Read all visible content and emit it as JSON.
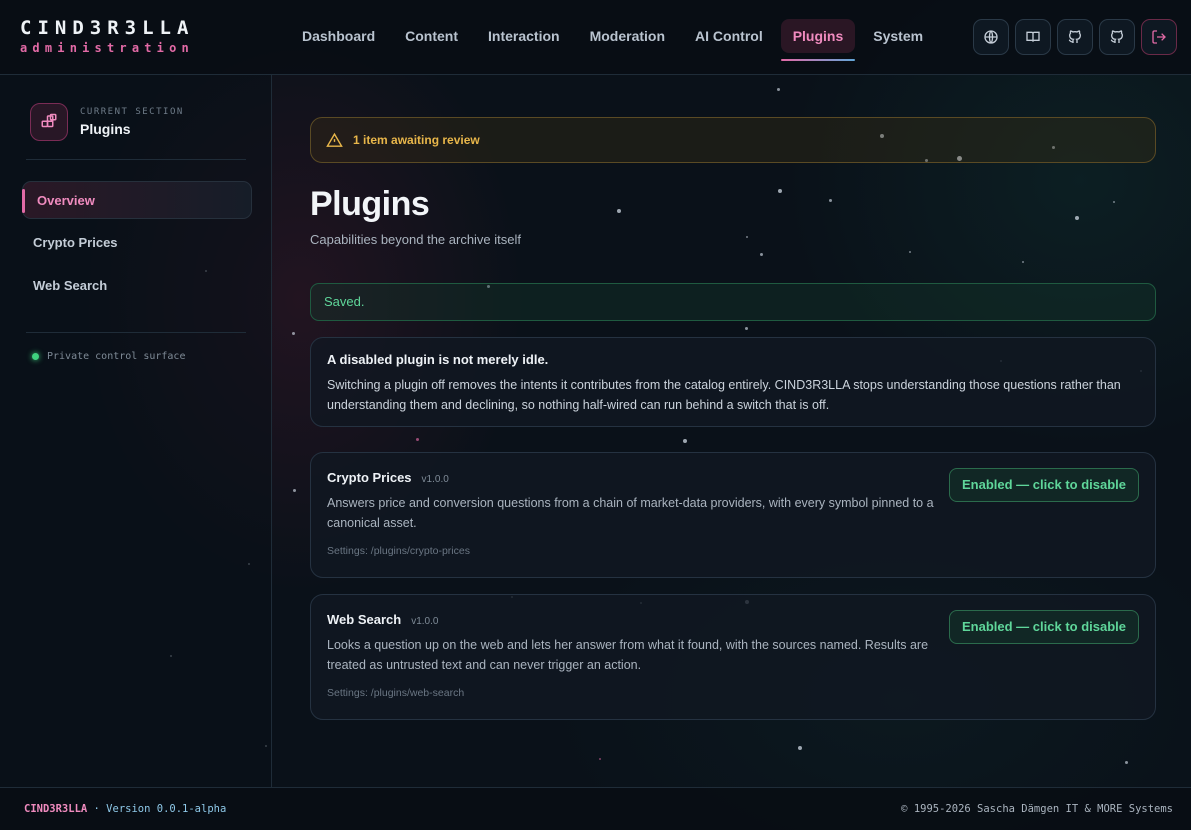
{
  "brand": {
    "title": "CIND3R3LLA",
    "subtitle": "administration"
  },
  "nav": {
    "items": [
      {
        "label": "Dashboard"
      },
      {
        "label": "Content"
      },
      {
        "label": "Interaction"
      },
      {
        "label": "Moderation"
      },
      {
        "label": "AI Control"
      },
      {
        "label": "Plugins",
        "active": true
      },
      {
        "label": "System"
      }
    ]
  },
  "toolbar": {
    "icons": [
      "globe-icon",
      "book-icon",
      "github-icon",
      "github-icon",
      "logout-icon"
    ]
  },
  "sidebar": {
    "kicker": "CURRENT SECTION",
    "section": "Plugins",
    "items": [
      {
        "label": "Overview",
        "active": true
      },
      {
        "label": "Crypto Prices"
      },
      {
        "label": "Web Search"
      }
    ],
    "status": "Private control surface"
  },
  "main": {
    "alert": "1 item awaiting review",
    "title": "Plugins",
    "subtitle": "Capabilities beyond the archive itself",
    "saved": "Saved.",
    "notice": {
      "title": "A disabled plugin is not merely idle.",
      "body": "Switching a plugin off removes the intents it contributes from the catalog entirely. CIND3R3LLA stops understanding those questions rather than understanding them and declining, so nothing half-wired can run behind a switch that is off."
    },
    "plugins": [
      {
        "name": "Crypto Prices",
        "version": "v1.0.0",
        "description": "Answers price and conversion questions from a chain of market-data providers, with every symbol pinned to a canonical asset.",
        "settings": "Settings: /plugins/crypto-prices",
        "toggle": "Enabled — click to disable"
      },
      {
        "name": "Web Search",
        "version": "v1.0.0",
        "description": "Looks a question up on the web and lets her answer from what it found, with the sources named. Results are treated as untrusted text and can never trigger an action.",
        "settings": "Settings: /plugins/web-search",
        "toggle": "Enabled — click to disable"
      }
    ]
  },
  "footer": {
    "brand": "CIND3R3LLA",
    "version": " · Version 0.0.1-alpha",
    "copyright": "© 1995-2026 Sascha Dämgen IT & MORE Systems"
  },
  "colors": {
    "accent_pink": "#e26aa6",
    "success_green": "#5fd69a",
    "warning_amber": "#e8b64a",
    "background": "#0a1119"
  }
}
